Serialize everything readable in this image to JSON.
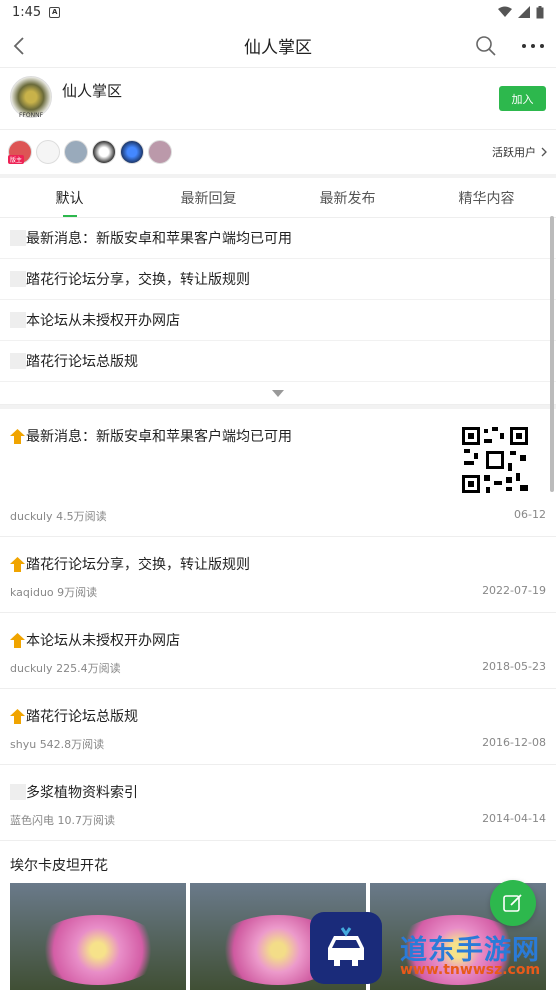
{
  "status_bar": {
    "time": "1:45",
    "notification_icon": "a-icon"
  },
  "title_bar": {
    "title": "仙人掌区"
  },
  "forum": {
    "name": "仙人掌区",
    "logo_text": "FFONNF",
    "join_label": "加入",
    "accent": "#2db84d"
  },
  "active_users": {
    "link_label": "活跃用户",
    "moderator_badge": "版主"
  },
  "tabs": [
    {
      "label": "默认",
      "active": true
    },
    {
      "label": "最新回复",
      "active": false
    },
    {
      "label": "最新发布",
      "active": false
    },
    {
      "label": "精华内容",
      "active": false
    }
  ],
  "notices": [
    "最新消息：新版安卓和苹果客户端均已可用",
    "踏花行论坛分享，交换，转让版规则",
    "本论坛从未授权开办网店",
    "踏花行论坛总版规"
  ],
  "posts": [
    {
      "title": "最新消息：新版安卓和苹果客户端均已可用",
      "author": "duckuly",
      "reads": "4.5万阅读",
      "date": "06-12",
      "pinned": true
    },
    {
      "title": "踏花行论坛分享，交换，转让版规则",
      "author": "kaqiduo",
      "reads": "9万阅读",
      "date": "2022-07-19",
      "pinned": true
    },
    {
      "title": "本论坛从未授权开办网店",
      "author": "duckuly",
      "reads": "225.4万阅读",
      "date": "2018-05-23",
      "pinned": true
    },
    {
      "title": "踏花行论坛总版规",
      "author": "shyu",
      "reads": "542.8万阅读",
      "date": "2016-12-08",
      "pinned": true
    },
    {
      "title": "多浆植物资料索引",
      "author": "蓝色闪电",
      "reads": "10.7万阅读",
      "date": "2014-04-14",
      "pinned": false
    }
  ],
  "gallery": {
    "title": "埃尔卡皮坦开花"
  },
  "watermark": {
    "text": "道东手游网",
    "url": "www.tnwwsz.com"
  }
}
